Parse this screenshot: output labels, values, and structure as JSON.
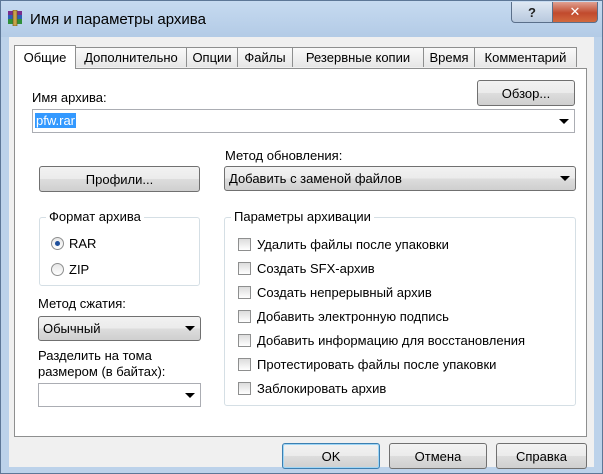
{
  "window": {
    "title": "Имя и параметры архива",
    "help_label": "?",
    "close_label": "✕"
  },
  "tabs": [
    {
      "label": "Общие",
      "active": true
    },
    {
      "label": "Дополнительно"
    },
    {
      "label": "Опции"
    },
    {
      "label": "Файлы"
    },
    {
      "label": "Резервные копии"
    },
    {
      "label": "Время"
    },
    {
      "label": "Комментарий"
    }
  ],
  "general": {
    "archive_name_label": "Имя архива:",
    "browse_label": "Обзор...",
    "archive_name_value": "pfw.rar",
    "profiles_label": "Профили...",
    "update_method_label": "Метод обновления:",
    "update_method_value": "Добавить с заменой файлов",
    "format_group_label": "Формат архива",
    "format_options": [
      {
        "label": "RAR",
        "selected": true
      },
      {
        "label": "ZIP",
        "selected": false
      }
    ],
    "compression_label": "Метод сжатия:",
    "compression_value": "Обычный",
    "split_label_line1": "Разделить на тома",
    "split_label_line2": "размером (в байтах):",
    "split_value": "",
    "options_group_label": "Параметры архивации",
    "options": [
      {
        "label": "Удалить файлы после упаковки",
        "checked": false
      },
      {
        "label": "Создать SFX-архив",
        "checked": false
      },
      {
        "label": "Создать непрерывный архив",
        "checked": false
      },
      {
        "label": "Добавить электронную подпись",
        "checked": false
      },
      {
        "label": "Добавить информацию для восстановления",
        "checked": false
      },
      {
        "label": "Протестировать файлы после упаковки",
        "checked": false
      },
      {
        "label": "Заблокировать архив",
        "checked": false
      }
    ]
  },
  "footer": {
    "ok_label": "OK",
    "cancel_label": "Отмена",
    "help_label": "Справка"
  }
}
